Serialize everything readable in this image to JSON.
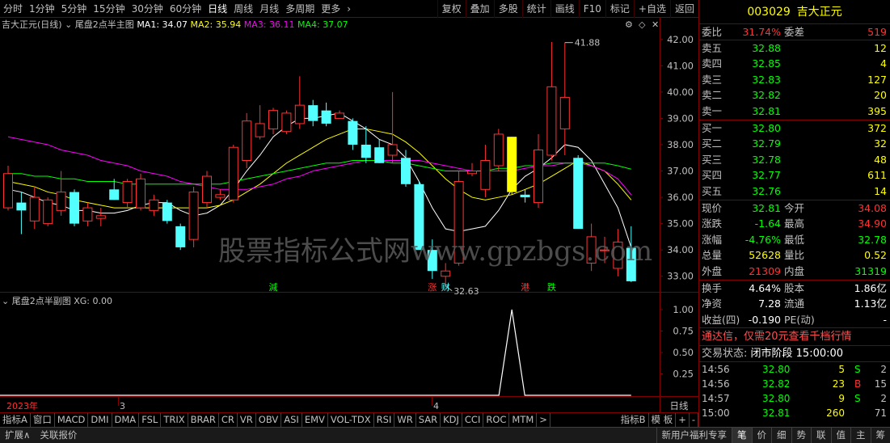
{
  "toolbar": {
    "periods": [
      "分时",
      "1分钟",
      "5分钟",
      "15分钟",
      "30分钟",
      "60分钟",
      "日线",
      "周线",
      "月线",
      "多周期",
      "更多"
    ],
    "active_period": "日线",
    "tools": [
      "复权",
      "叠加",
      "多股",
      "统计",
      "画线",
      "F10",
      "标记",
      "+自选",
      "返回"
    ]
  },
  "main_chart": {
    "stock_label": "吉大正元(日线)",
    "indicator_name": "尾盘2点半主图",
    "ma1": "MA1: 34.07",
    "ma2": "MA2: 35.94",
    "ma3": "MA3: 36.11",
    "ma4": "MA4: 37.07",
    "price_axis": [
      "42.00",
      "41.00",
      "40.00",
      "39.00",
      "38.00",
      "37.00",
      "36.00",
      "35.00",
      "34.00",
      "33.00"
    ],
    "high_mark": "41.88",
    "low_mark": "32.63",
    "event_labels": [
      "減",
      "涨",
      "财",
      "港",
      "跌"
    ],
    "watermark": "股票指标公式网www.gpzbgs.com"
  },
  "sub_chart": {
    "title": "尾盘2点半副图",
    "xg": "XG: 0.00",
    "axis": [
      "1.00",
      "0.75",
      "0.50",
      "0.25"
    ]
  },
  "time_axis": {
    "labels": [
      "2023年",
      "3",
      "4"
    ],
    "period_label": "日线"
  },
  "indicator_tabs": [
    "指标A",
    "窗口",
    "MACD",
    "DMI",
    "DMA",
    "FSL",
    "TRIX",
    "BRAR",
    "CR",
    "VR",
    "OBV",
    "ASI",
    "EMV",
    "VOL-TDX",
    "RSI",
    "WR",
    "SAR",
    "KDJ",
    "CCI",
    "ROC",
    "MTM",
    ">"
  ],
  "indicator_tabs_right": [
    "指标B",
    "模 板",
    "+",
    "-"
  ],
  "statusbar": {
    "left": [
      "扩展∧",
      "关联报价"
    ],
    "right": [
      "新用户福利专享",
      "笔",
      "价",
      "细",
      "势",
      "联",
      "值",
      "主",
      "筹"
    ]
  },
  "quote": {
    "code": "003029",
    "name": "吉大正元",
    "weibi_label": "委比",
    "weibi": "31.74%",
    "weicha_label": "委差",
    "weicha": "519",
    "sells": [
      {
        "label": "卖五",
        "price": "32.88",
        "vol": "12"
      },
      {
        "label": "卖四",
        "price": "32.85",
        "vol": "4"
      },
      {
        "label": "卖三",
        "price": "32.83",
        "vol": "127"
      },
      {
        "label": "卖二",
        "price": "32.82",
        "vol": "20"
      },
      {
        "label": "卖一",
        "price": "32.81",
        "vol": "395"
      }
    ],
    "buys": [
      {
        "label": "买一",
        "price": "32.80",
        "vol": "372"
      },
      {
        "label": "买二",
        "price": "32.79",
        "vol": "32"
      },
      {
        "label": "买三",
        "price": "32.78",
        "vol": "48"
      },
      {
        "label": "买四",
        "price": "32.77",
        "vol": "611"
      },
      {
        "label": "买五",
        "price": "32.76",
        "vol": "14"
      }
    ],
    "stats": [
      {
        "l1": "现价",
        "v1": "32.81",
        "c1": "green",
        "l2": "今开",
        "v2": "34.08",
        "c2": "red"
      },
      {
        "l1": "涨跌",
        "v1": "-1.64",
        "c1": "green",
        "l2": "最高",
        "v2": "34.90",
        "c2": "red"
      },
      {
        "l1": "涨幅",
        "v1": "-4.76%",
        "c1": "green",
        "l2": "最低",
        "v2": "32.78",
        "c2": "green"
      },
      {
        "l1": "总量",
        "v1": "52628",
        "c1": "yellow",
        "l2": "量比",
        "v2": "0.52",
        "c2": "yellow"
      },
      {
        "l1": "外盘",
        "v1": "21309",
        "c1": "red",
        "l2": "内盘",
        "v2": "31319",
        "c2": "green"
      }
    ],
    "fin": [
      {
        "l1": "换手",
        "v1": "4.64%",
        "l2": "股本",
        "v2": "1.86亿"
      },
      {
        "l1": "净资",
        "v1": "7.28",
        "l2": "流通",
        "v2": "1.13亿"
      },
      {
        "l1": "收益(四)",
        "v1": "-0.190",
        "l2": "PE(动)",
        "v2": "-"
      }
    ],
    "promo": "通达信，仅需20元查看千档行情",
    "state_label": "交易状态:",
    "state_value": "闭市阶段 15:00:00",
    "ticks": [
      {
        "time": "14:56",
        "price": "32.80",
        "vol": "5",
        "bs": "S",
        "n": "2"
      },
      {
        "time": "14:56",
        "price": "32.82",
        "vol": "23",
        "bs": "B",
        "n": "15"
      },
      {
        "time": "14:57",
        "price": "32.80",
        "vol": "9",
        "bs": "S",
        "n": "2"
      },
      {
        "time": "15:00",
        "price": "32.81",
        "vol": "260",
        "bs": "",
        "n": "71"
      }
    ]
  },
  "chart_data": {
    "type": "candlestick",
    "candles": [
      {
        "o": 35.6,
        "h": 37.2,
        "l": 35.5,
        "c": 36.9
      },
      {
        "o": 35.8,
        "h": 36.2,
        "l": 34.6,
        "c": 35.5
      },
      {
        "o": 35.1,
        "h": 36.4,
        "l": 34.8,
        "c": 36.0
      },
      {
        "o": 35.0,
        "h": 36.0,
        "l": 34.9,
        "c": 35.9
      },
      {
        "o": 35.5,
        "h": 37.0,
        "l": 35.3,
        "c": 36.2
      },
      {
        "o": 36.2,
        "h": 36.3,
        "l": 34.9,
        "c": 35.0
      },
      {
        "o": 35.1,
        "h": 35.8,
        "l": 34.9,
        "c": 35.6
      },
      {
        "o": 35.2,
        "h": 35.6,
        "l": 34.9,
        "c": 35.3
      },
      {
        "o": 36.3,
        "h": 36.7,
        "l": 35.9,
        "c": 35.9
      },
      {
        "o": 35.8,
        "h": 36.7,
        "l": 35.6,
        "c": 36.6
      },
      {
        "o": 35.6,
        "h": 36.9,
        "l": 35.5,
        "c": 36.7
      },
      {
        "o": 35.5,
        "h": 36.1,
        "l": 35.3,
        "c": 35.9
      },
      {
        "o": 35.8,
        "h": 35.9,
        "l": 35.0,
        "c": 35.1
      },
      {
        "o": 34.9,
        "h": 35.0,
        "l": 34.0,
        "c": 34.1
      },
      {
        "o": 34.4,
        "h": 36.4,
        "l": 34.1,
        "c": 36.2
      },
      {
        "o": 35.8,
        "h": 37.0,
        "l": 35.6,
        "c": 36.8
      },
      {
        "o": 36.0,
        "h": 36.3,
        "l": 35.9,
        "c": 36.1
      },
      {
        "o": 35.9,
        "h": 38.0,
        "l": 35.8,
        "c": 37.9
      },
      {
        "o": 37.4,
        "h": 39.2,
        "l": 37.1,
        "c": 38.9
      },
      {
        "o": 38.3,
        "h": 39.5,
        "l": 38.2,
        "c": 38.8
      },
      {
        "o": 38.6,
        "h": 39.4,
        "l": 38.4,
        "c": 39.3
      },
      {
        "o": 38.5,
        "h": 39.3,
        "l": 38.4,
        "c": 39.2
      },
      {
        "o": 38.8,
        "h": 40.6,
        "l": 38.6,
        "c": 39.5
      },
      {
        "o": 39.5,
        "h": 39.7,
        "l": 38.7,
        "c": 38.9
      },
      {
        "o": 39.3,
        "h": 39.6,
        "l": 38.7,
        "c": 38.8
      },
      {
        "o": 39.0,
        "h": 39.3,
        "l": 39.0,
        "c": 39.2
      },
      {
        "o": 38.9,
        "h": 39.0,
        "l": 37.8,
        "c": 38.0
      },
      {
        "o": 38.0,
        "h": 38.7,
        "l": 37.3,
        "c": 37.5
      },
      {
        "o": 37.9,
        "h": 38.2,
        "l": 37.3,
        "c": 37.3
      },
      {
        "o": 37.6,
        "h": 40.0,
        "l": 37.3,
        "c": 38.0
      },
      {
        "o": 37.5,
        "h": 37.8,
        "l": 36.4,
        "c": 36.5
      },
      {
        "o": 36.5,
        "h": 36.6,
        "l": 34.6,
        "c": 34.0
      },
      {
        "o": 34.0,
        "h": 34.4,
        "l": 32.9,
        "c": 33.2
      },
      {
        "o": 33.0,
        "h": 33.5,
        "l": 32.63,
        "c": 33.2
      },
      {
        "o": 33.5,
        "h": 37.0,
        "l": 33.4,
        "c": 36.6
      },
      {
        "o": 36.9,
        "h": 37.3,
        "l": 36.8,
        "c": 37.0
      },
      {
        "o": 36.3,
        "h": 38.0,
        "l": 36.0,
        "c": 37.4
      },
      {
        "o": 37.2,
        "h": 38.6,
        "l": 37.0,
        "c": 38.4
      },
      {
        "o": 36.2,
        "h": 38.3,
        "l": 36.1,
        "c": 38.3
      },
      {
        "o": 36.1,
        "h": 36.3,
        "l": 35.8,
        "c": 36.0
      },
      {
        "o": 35.8,
        "h": 38.4,
        "l": 35.6,
        "c": 37.8
      },
      {
        "o": 37.6,
        "h": 41.9,
        "l": 37.4,
        "c": 40.2
      },
      {
        "o": 38.6,
        "h": 41.88,
        "l": 37.6,
        "c": 39.8
      },
      {
        "o": 37.5,
        "h": 37.6,
        "l": 34.8,
        "c": 34.8
      },
      {
        "o": 33.5,
        "h": 35.0,
        "l": 33.2,
        "c": 34.5
      },
      {
        "o": 34.0,
        "h": 34.5,
        "l": 33.5,
        "c": 34.0
      },
      {
        "o": 33.3,
        "h": 34.8,
        "l": 33.0,
        "c": 34.3
      },
      {
        "o": 34.08,
        "h": 34.9,
        "l": 32.78,
        "c": 32.81
      }
    ],
    "highlight_index": 38,
    "ma_series": [
      {
        "name": "MA1",
        "color": "#ffffff",
        "values": [
          36.3,
          36.2,
          36.0,
          35.8,
          35.7,
          35.5,
          35.5,
          35.4,
          35.4,
          35.5,
          35.7,
          35.8,
          35.8,
          35.5,
          35.3,
          35.4,
          35.7,
          36.3,
          37.0,
          37.6,
          38.3,
          38.7,
          39.0,
          39.0,
          39.1,
          39.2,
          38.9,
          38.6,
          38.2,
          38.0,
          37.5,
          36.6,
          35.6,
          34.8,
          34.7,
          34.8,
          34.9,
          35.5,
          36.3,
          36.8,
          37.1,
          37.5,
          38.0,
          37.9,
          37.4,
          36.5,
          35.6,
          34.1
        ]
      },
      {
        "name": "MA2",
        "color": "#ffff00",
        "values": [
          36.6,
          36.5,
          36.4,
          36.2,
          36.1,
          35.9,
          35.8,
          35.7,
          35.6,
          35.6,
          35.6,
          35.6,
          35.6,
          35.6,
          35.6,
          35.6,
          35.7,
          35.9,
          36.2,
          36.5,
          36.9,
          37.3,
          37.6,
          37.9,
          38.2,
          38.4,
          38.6,
          38.6,
          38.5,
          38.4,
          38.1,
          37.7,
          37.2,
          36.7,
          36.3,
          36.0,
          35.9,
          36.0,
          36.1,
          36.3,
          36.5,
          36.8,
          37.1,
          37.4,
          37.2,
          37.0,
          36.5,
          35.9
        ]
      },
      {
        "name": "MA3",
        "color": "#ff00ff",
        "values": [
          38.3,
          38.2,
          38.1,
          38.0,
          37.8,
          37.7,
          37.6,
          37.4,
          37.3,
          37.2,
          37.0,
          36.9,
          36.8,
          36.6,
          36.5,
          36.4,
          36.3,
          36.3,
          36.3,
          36.4,
          36.5,
          36.7,
          36.8,
          37.0,
          37.1,
          37.2,
          37.3,
          37.4,
          37.4,
          37.4,
          37.4,
          37.4,
          37.3,
          37.2,
          37.1,
          37.0,
          37.0,
          37.0,
          37.0,
          37.1,
          37.2,
          37.2,
          37.3,
          37.3,
          37.2,
          37.0,
          36.7,
          36.1
        ]
      },
      {
        "name": "MA4",
        "color": "#00ff00",
        "values": [
          36.9,
          36.9,
          36.8,
          36.8,
          36.7,
          36.7,
          36.6,
          36.6,
          36.6,
          36.5,
          36.5,
          36.5,
          36.5,
          36.5,
          36.5,
          36.5,
          36.5,
          36.6,
          36.7,
          36.8,
          36.9,
          37.0,
          37.1,
          37.2,
          37.3,
          37.3,
          37.4,
          37.4,
          37.4,
          37.3,
          37.3,
          37.2,
          37.1,
          37.0,
          37.0,
          37.0,
          37.0,
          37.1,
          37.1,
          37.2,
          37.2,
          37.3,
          37.3,
          37.3,
          37.3,
          37.3,
          37.2,
          37.07
        ]
      }
    ],
    "xg_signal_index": 38,
    "ylim": [
      32.5,
      42.3
    ]
  }
}
